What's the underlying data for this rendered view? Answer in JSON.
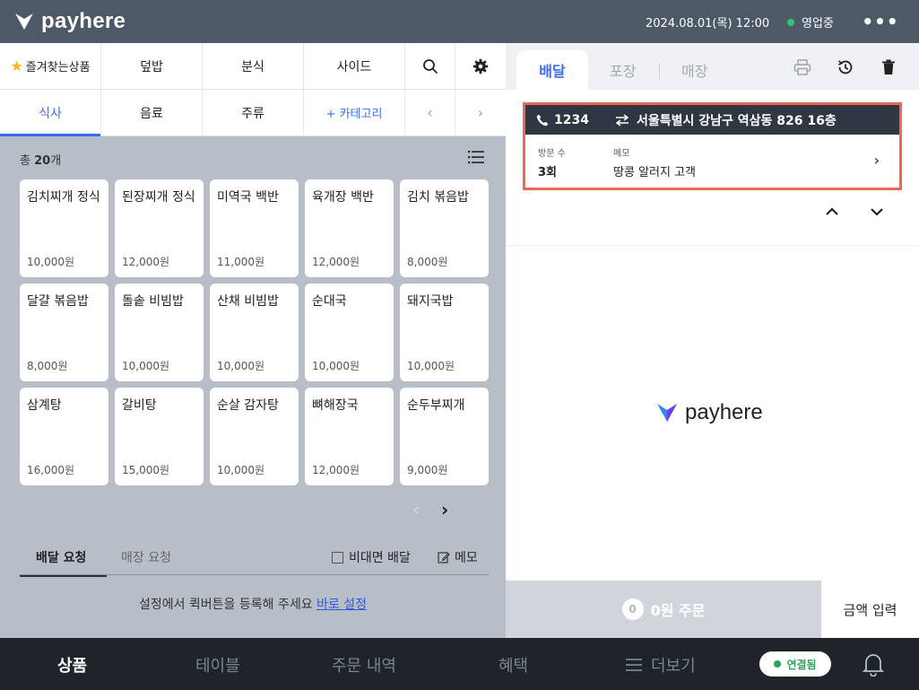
{
  "topbar": {
    "logo_text": "payhere",
    "datetime": "2024.08.01(목) 12:00",
    "status": "영업중",
    "more_label": "•••"
  },
  "categories": {
    "row1": [
      "즐겨찾는상품",
      "덮밥",
      "분식",
      "사이드"
    ],
    "row2": [
      "식사",
      "음료",
      "주류"
    ],
    "add_category": "+ 카테고리",
    "active": "식사"
  },
  "product_count": {
    "prefix": "총 ",
    "value": "20",
    "suffix": "개"
  },
  "products": [
    {
      "name": "김치찌개 정식",
      "price": "10,000원"
    },
    {
      "name": "된장찌개 정식",
      "price": "12,000원"
    },
    {
      "name": "미역국 백반",
      "price": "11,000원"
    },
    {
      "name": "육개장 백반",
      "price": "12,000원"
    },
    {
      "name": "김치 볶음밥",
      "price": "8,000원"
    },
    {
      "name": "달걀 볶음밥",
      "price": "8,000원"
    },
    {
      "name": "돌솥 비빔밥",
      "price": "10,000원"
    },
    {
      "name": "산채 비빔밥",
      "price": "10,000원"
    },
    {
      "name": "순대국",
      "price": "10,000원"
    },
    {
      "name": "돼지국밥",
      "price": "10,000원"
    },
    {
      "name": "삼계탕",
      "price": "16,000원"
    },
    {
      "name": "갈비탕",
      "price": "15,000원"
    },
    {
      "name": "순살 감자탕",
      "price": "10,000원"
    },
    {
      "name": "뼈해장국",
      "price": "12,000원"
    },
    {
      "name": "순두부찌개",
      "price": "9,000원"
    }
  ],
  "requests": {
    "tab_delivery": "배달 요청",
    "tab_store": "매장 요청",
    "contactless": "비대면 배달",
    "memo": "메모",
    "quick_text": "설정에서 퀵버튼을 등록해 주세요 ",
    "quick_link": "바로 설정"
  },
  "order_tabs": [
    "배달",
    "포장",
    "매장"
  ],
  "customer": {
    "phone": "1234",
    "address": "서울특별시 강남구 역삼동 826 16층",
    "visits_label": "방문 수",
    "visits_value": "3회",
    "memo_label": "메모",
    "memo_value": "땅콩 알러지 고객"
  },
  "center_logo": "payhere",
  "order_bar": {
    "count": "0",
    "label": "0원 주문"
  },
  "amount_input": "금액 입력",
  "bottom_nav": {
    "items": [
      "상품",
      "테이블",
      "주문 내역",
      "혜택",
      "더보기"
    ],
    "connected": "연결됨"
  },
  "colors": {
    "accent": "#3a6cf4",
    "topbar": "#4e5968",
    "highlight_border": "#e9685a",
    "status_green": "#2fc76a"
  }
}
